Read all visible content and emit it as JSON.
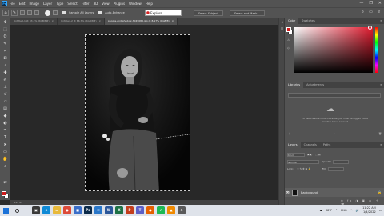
{
  "app": {
    "logo": "Ps",
    "window_controls": [
      "—",
      "❐",
      "✕"
    ]
  },
  "menu": [
    "File",
    "Edit",
    "Image",
    "Layer",
    "Type",
    "Select",
    "Filter",
    "3D",
    "View",
    "Plugins",
    "Window",
    "Help"
  ],
  "options": {
    "sample_all_layers": "Sample All Layers",
    "auto_enhance": "Auto-Enhance",
    "select_subject": "Select Subject",
    "select_and_mask": "Select and Mask...",
    "search_text": "Explore"
  },
  "tabs": [
    {
      "label": "Untitled-1 @ 33.3% (RGB/8#)",
      "close": "×"
    },
    {
      "label": "Untitled-2 @ 66.7% (RGB/8#)",
      "close": "×"
    },
    {
      "label": "people-and-shadow-3049088.jpg @ 8.17% (RGB/8)",
      "close": "×"
    }
  ],
  "status": {
    "zoom": "8.17%"
  },
  "panels": {
    "color": {
      "tabs": [
        "Color",
        "Swatches"
      ]
    },
    "libraries": {
      "tabs": [
        "Libraries",
        "Adjustments"
      ],
      "message": "To use Creative Cloud Libraries, you must be logged into a Creative Cloud account."
    },
    "layers": {
      "tabs": [
        "Layers",
        "Channels",
        "Paths"
      ],
      "kind_label": "Kind",
      "blend_mode": "Normal",
      "opacity_label": "Opacity:",
      "lock_label": "Lock:",
      "fill_label": "Fill:",
      "layer_name": "Background"
    }
  },
  "taskbar": {
    "temperature": "38°F",
    "lang": "ENG",
    "time": "11:22 AM",
    "date": "1/4/2022",
    "apps": [
      {
        "name": "task-view",
        "color": "#3a3a3a",
        "glyph": "▣"
      },
      {
        "name": "edge",
        "color": "#0f8ad6",
        "glyph": "e"
      },
      {
        "name": "file-explorer",
        "color": "#e8b93b",
        "glyph": "▬"
      },
      {
        "name": "chrome",
        "color": "#dd4b39",
        "glyph": "●"
      },
      {
        "name": "store",
        "color": "#3a6ec9",
        "glyph": "■"
      },
      {
        "name": "photoshop",
        "color": "#0b2a4a",
        "glyph": "Ps"
      },
      {
        "name": "mail",
        "color": "#2a77c9",
        "glyph": "✉"
      },
      {
        "name": "word",
        "color": "#2b579a",
        "glyph": "W"
      },
      {
        "name": "excel",
        "color": "#1e7145",
        "glyph": "X"
      },
      {
        "name": "powerpoint",
        "color": "#c43e1c",
        "glyph": "P"
      },
      {
        "name": "teams",
        "color": "#5b5fc7",
        "glyph": "T"
      },
      {
        "name": "firefox",
        "color": "#e66000",
        "glyph": "●"
      },
      {
        "name": "spotify",
        "color": "#1db954",
        "glyph": "♪"
      },
      {
        "name": "vlc",
        "color": "#f08a00",
        "glyph": "▲"
      },
      {
        "name": "settings",
        "color": "#5a5a5a",
        "glyph": "⚙"
      }
    ]
  },
  "colors": {
    "foreground": "#d01b1b",
    "background": "#ffffff",
    "accent": "#31a8ff"
  }
}
